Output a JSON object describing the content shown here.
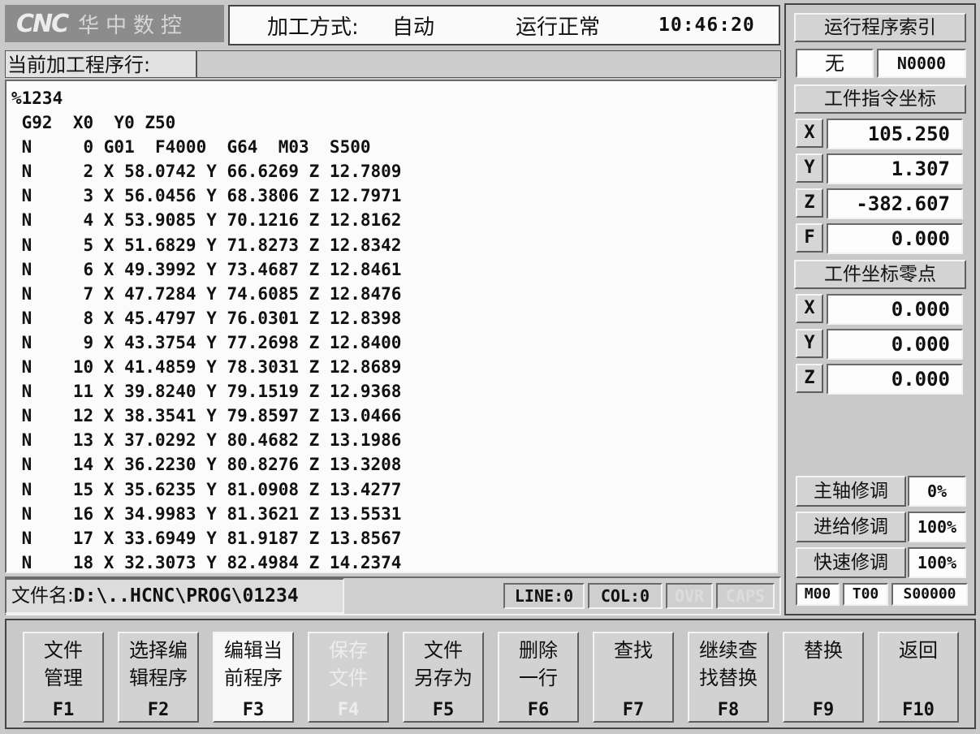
{
  "header": {
    "logo_mark": "CNC",
    "logo_text": "华中数控",
    "mode_label": "加工方式:",
    "mode_value": "自动",
    "run_status": "运行正常",
    "clock": "10:46:20"
  },
  "current_line": {
    "label": "当前加工程序行:",
    "value": ""
  },
  "program_lines": [
    "%1234",
    " G92  X0  Y0 Z50",
    " N     0 G01  F4000  G64  M03  S500",
    " N     2 X 58.0742 Y 66.6269 Z 12.7809",
    " N     3 X 56.0456 Y 68.3806 Z 12.7971",
    " N     4 X 53.9085 Y 70.1216 Z 12.8162",
    " N     5 X 51.6829 Y 71.8273 Z 12.8342",
    " N     6 X 49.3992 Y 73.4687 Z 12.8461",
    " N     7 X 47.7284 Y 74.6085 Z 12.8476",
    " N     8 X 45.4797 Y 76.0301 Z 12.8398",
    " N     9 X 43.3754 Y 77.2698 Z 12.8400",
    " N    10 X 41.4859 Y 78.3031 Z 12.8689",
    " N    11 X 39.8240 Y 79.1519 Z 12.9368",
    " N    12 X 38.3541 Y 79.8597 Z 13.0466",
    " N    13 X 37.0292 Y 80.4682 Z 13.1986",
    " N    14 X 36.2230 Y 80.8276 Z 13.3208",
    " N    15 X 35.6235 Y 81.0908 Z 13.4277",
    " N    16 X 34.9983 Y 81.3621 Z 13.5531",
    " N    17 X 33.6949 Y 81.9187 Z 13.8567",
    " N    18 X 32.3073 Y 82.4984 Z 14.2374"
  ],
  "file_bar": {
    "file_label": "文件名:",
    "file_path": "D:\\..HCNC\\PROG\\01234",
    "line": "LINE:0",
    "col": "COL:0",
    "ovr": "OVR",
    "caps": "CAPS"
  },
  "right_panel": {
    "index_title": "运行程序索引",
    "index_left": "无",
    "index_right": "N0000",
    "cmd_title": "工件指令坐标",
    "cmd_coords": [
      {
        "axis": "X",
        "value": "105.250"
      },
      {
        "axis": "Y",
        "value": "1.307"
      },
      {
        "axis": "Z",
        "value": "-382.607"
      },
      {
        "axis": "F",
        "value": "0.000"
      }
    ],
    "zero_title": "工件坐标零点",
    "zero_coords": [
      {
        "axis": "X",
        "value": "0.000"
      },
      {
        "axis": "Y",
        "value": "0.000"
      },
      {
        "axis": "Z",
        "value": "0.000"
      }
    ],
    "overrides": [
      {
        "label": "主轴修调",
        "value": "0%"
      },
      {
        "label": "进给修调",
        "value": "100%"
      },
      {
        "label": "快速修调",
        "value": "100%"
      }
    ],
    "m_code": "M00",
    "t_code": "T00",
    "s_code": "S00000"
  },
  "fkeys": [
    {
      "label": "文件\n管理",
      "code": "F1"
    },
    {
      "label": "选择编\n辑程序",
      "code": "F2"
    },
    {
      "label": "编辑当\n前程序",
      "code": "F3"
    },
    {
      "label": "保存\n文件",
      "code": "F4"
    },
    {
      "label": "文件\n另存为",
      "code": "F5"
    },
    {
      "label": "删除\n一行",
      "code": "F6"
    },
    {
      "label": "查找",
      "code": "F7"
    },
    {
      "label": "继续查\n找替换",
      "code": "F8"
    },
    {
      "label": "替换",
      "code": "F9"
    },
    {
      "label": "返回",
      "code": "F10"
    }
  ]
}
